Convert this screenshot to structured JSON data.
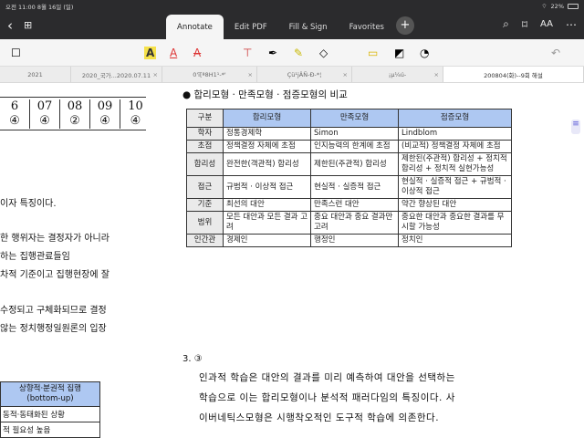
{
  "status": {
    "time": "오전 11:00",
    "date": "8월 16일 (일)",
    "battery": "22%"
  },
  "topbar": {
    "tabs": [
      "Annotate",
      "Edit PDF",
      "Fill & Sign",
      "Favorites"
    ],
    "active_tab": "Annotate",
    "add_label": "+",
    "text_size_label": "AA"
  },
  "doc_tabs": [
    "2021",
    "2020_국가...2020.07.11",
    "0'ï[ª8H1¹-*'",
    "Çü¹jÄÑ-Ð-*¦",
    "¡µ¼ú-",
    "200804(화)--9회 해설"
  ],
  "left_panel": {
    "answers": [
      "6",
      "07",
      "08",
      "09",
      "10"
    ],
    "answer_marks": [
      "④",
      "④",
      "②",
      "④",
      "④"
    ],
    "lines": [
      "이자 특징이다.",
      "한 행위자는 결정자가 아니라",
      "하는 집행관료들임",
      "차적 기준이고 집행현장에 잘",
      "수정되고 구체화되므로 결정",
      "않는 정치행정일원론의 입장"
    ],
    "mini_table": {
      "header": [
        "상향적·분권적 집행",
        "(bottom-up)"
      ],
      "rows": [
        "동적·동태화된 상황",
        "적 필요성 높음"
      ]
    }
  },
  "heading": "합리모형 · 만족모형 · 점증모형의 비교",
  "table": {
    "headers": [
      "구분",
      "합리모형",
      "만족모형",
      "점증모형"
    ],
    "rows": [
      {
        "label": "학자",
        "c1": "정통경제학",
        "c2": "Simon",
        "c3": "Lindblom"
      },
      {
        "label": "초점",
        "c1": "정책결정 자체에 초점",
        "c2": "인지능력의 한계에 초점",
        "c3": "(비교적) 정책결정 자체에 초점"
      },
      {
        "label": "합리성",
        "c1": "완전한(객관적) 합리성",
        "c2": "제한된(주관적) 합리성",
        "c3": "제한된(주관적) 합리성 + 정치적 합리성 + 정치적 실현가능성"
      },
      {
        "label": "접근",
        "c1": "규범적 · 이상적 접근",
        "c2": "현실적 · 실증적 접근",
        "c3": "현실적 · 실증적 접근 + 규범적 · 이상적 접근"
      },
      {
        "label": "기준",
        "c1": "최선의 대안",
        "c2": "만족스런 대안",
        "c3": "약간 향상된 대안"
      },
      {
        "label": "범위",
        "c1": "모든 대안과 모든 결과 고려",
        "c2": "중요 대안과 중요 결과만 고려",
        "c3": "중요한 대안과 중요한 결과를 무시할 가능성"
      },
      {
        "label": "인간관",
        "c1": "경제인",
        "c2": "행정인",
        "c3": "정치인"
      }
    ]
  },
  "answer3": {
    "number": "3. ③",
    "lines": [
      "인과적 학습은 대안의 결과를 미리 예측하여 대안을 선택하는",
      "학습으로 이는 합리모형이나 분석적 패러다임의 특징이다. 사",
      "이버네틱스모형은 시행착오적인 도구적 학습에 의존한다."
    ]
  },
  "colors": {
    "header_bg": "#aec8f2",
    "toolbar_bg": "#2b2b2d"
  }
}
